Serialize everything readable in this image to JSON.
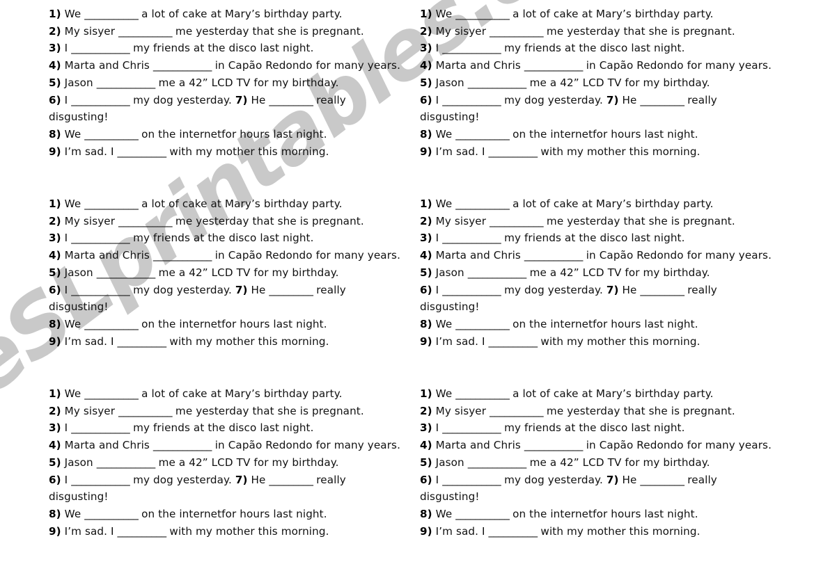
{
  "document": {
    "type": "esl-worksheet",
    "page_background": "#ffffff",
    "text_color": "#111111"
  },
  "watermark": {
    "text": "eSLprintables.com",
    "color": "#c9c9c9",
    "rotation_deg": -37
  },
  "worksheet": {
    "copies": 6,
    "columns": 2,
    "rows": 3,
    "sentences": [
      {
        "number": "1)",
        "before": "We",
        "blank": "___________",
        "after": "a lot of cake at Mary’s birthday party."
      },
      {
        "number": "2)",
        "before": "My sisyer",
        "blank": "___________",
        "after": "me yesterday that she is pregnant."
      },
      {
        "number": "3)",
        "before": "I",
        "blank": "____________",
        "after": "my friends at the disco last night."
      },
      {
        "number": "4)",
        "before": "Marta and Chris",
        "blank": "____________",
        "after": "in Capão Redondo for many years."
      },
      {
        "number": "5)",
        "before": "Jason",
        "blank": "____________",
        "after": "me a 42” LCD TV for my birthday."
      },
      {
        "number": "6)",
        "before": "I",
        "blank": "____________",
        "after": "my dog yesterday.",
        "number2": "7)",
        "before2": "He",
        "blank2": "_________",
        "after2": "really disgusting!"
      },
      {
        "number": "8)",
        "before": "We",
        "blank": "___________",
        "after": "on the internetfor hours last night."
      },
      {
        "number": "9)",
        "before": "I’m sad. I",
        "blank": "__________",
        "after": "with my mother this morning."
      }
    ]
  }
}
